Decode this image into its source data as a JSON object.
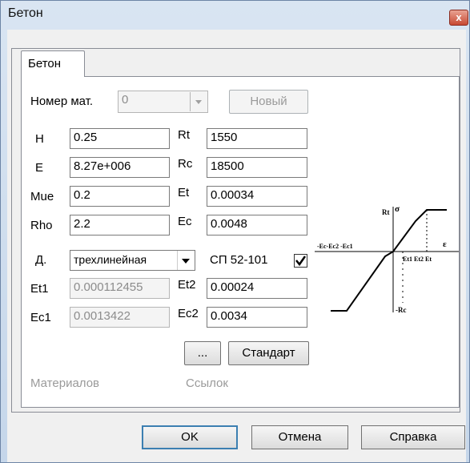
{
  "window": {
    "title": "Бетон",
    "close_glyph": "x"
  },
  "tab": {
    "label": "Бетон"
  },
  "material": {
    "number_label": "Номер мат.",
    "number_value": "0",
    "new_button": "Новый"
  },
  "left_params": [
    {
      "label": "H",
      "value": "0.25",
      "enabled": true
    },
    {
      "label": "E",
      "value": "8.27e+006",
      "enabled": true
    },
    {
      "label": "Mue",
      "value": "0.2",
      "enabled": true
    },
    {
      "label": "Rho",
      "value": "2.2",
      "enabled": true
    }
  ],
  "right_params": [
    {
      "label": "Rt",
      "value": "1550"
    },
    {
      "label": "Rc",
      "value": "18500"
    },
    {
      "label": "Et",
      "value": "0.00034"
    },
    {
      "label": "Ec",
      "value": "0.0048"
    }
  ],
  "diagram": {
    "label": "Д.",
    "selected": "трехлинейная",
    "sp_label": "СП 52-101",
    "sp_checked": true
  },
  "extra": {
    "et1_label": "Et1",
    "et1_value": "0.000112455",
    "ec1_label": "Ec1",
    "ec1_value": "0.0013422",
    "et2_label": "Et2",
    "et2_value": "0.00024",
    "ec2_label": "Ec2",
    "ec2_value": "0.0034"
  },
  "buttons": {
    "ellipsis": "...",
    "standard": "Стандарт",
    "ok": "OK",
    "cancel": "Отмена",
    "help": "Справка"
  },
  "footer_links": {
    "materials": "Материалов",
    "refs": "Ссылок"
  },
  "graph_labels": {
    "rt": "Rt",
    "sigma": "σ",
    "eps": "ε",
    "neg_axis": "-Ec-Ec2 -Ec1",
    "pos_axis": "Et1 Et2 Et",
    "rc": "-Rc"
  }
}
